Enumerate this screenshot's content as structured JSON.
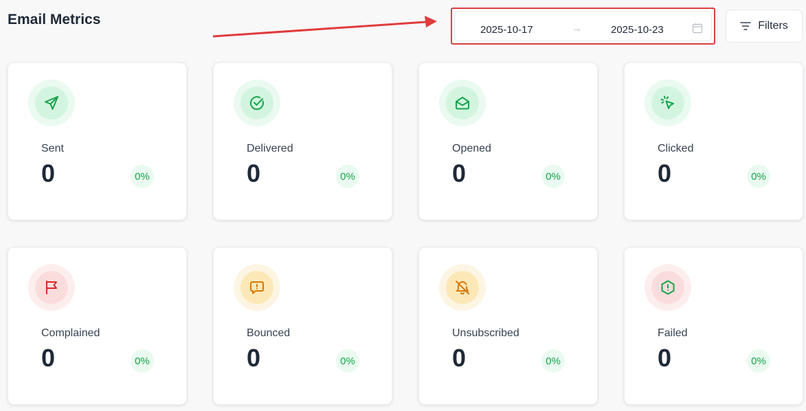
{
  "header": {
    "title": "Email Metrics",
    "date_start": "2025-10-17",
    "date_separator": "→",
    "date_end": "2025-10-23",
    "filters_label": "Filters"
  },
  "colors": {
    "annotation": "#e03c3c",
    "success": "#16a34a",
    "danger": "#dc2626",
    "warning": "#d97706"
  },
  "metrics": [
    {
      "label": "Sent",
      "value": "0",
      "percent": "0%",
      "icon": "send-icon",
      "tone": "green"
    },
    {
      "label": "Delivered",
      "value": "0",
      "percent": "0%",
      "icon": "check-circle-icon",
      "tone": "green"
    },
    {
      "label": "Opened",
      "value": "0",
      "percent": "0%",
      "icon": "mail-open-icon",
      "tone": "green"
    },
    {
      "label": "Clicked",
      "value": "0",
      "percent": "0%",
      "icon": "cursor-click-icon",
      "tone": "green"
    },
    {
      "label": "Complained",
      "value": "0",
      "percent": "0%",
      "icon": "flag-icon",
      "tone": "red"
    },
    {
      "label": "Bounced",
      "value": "0",
      "percent": "0%",
      "icon": "message-alert-icon",
      "tone": "amber"
    },
    {
      "label": "Unsubscribed",
      "value": "0",
      "percent": "0%",
      "icon": "bell-off-icon",
      "tone": "amber"
    },
    {
      "label": "Failed",
      "value": "0",
      "percent": "0%",
      "icon": "octagon-alert-icon",
      "tone": "red"
    }
  ]
}
